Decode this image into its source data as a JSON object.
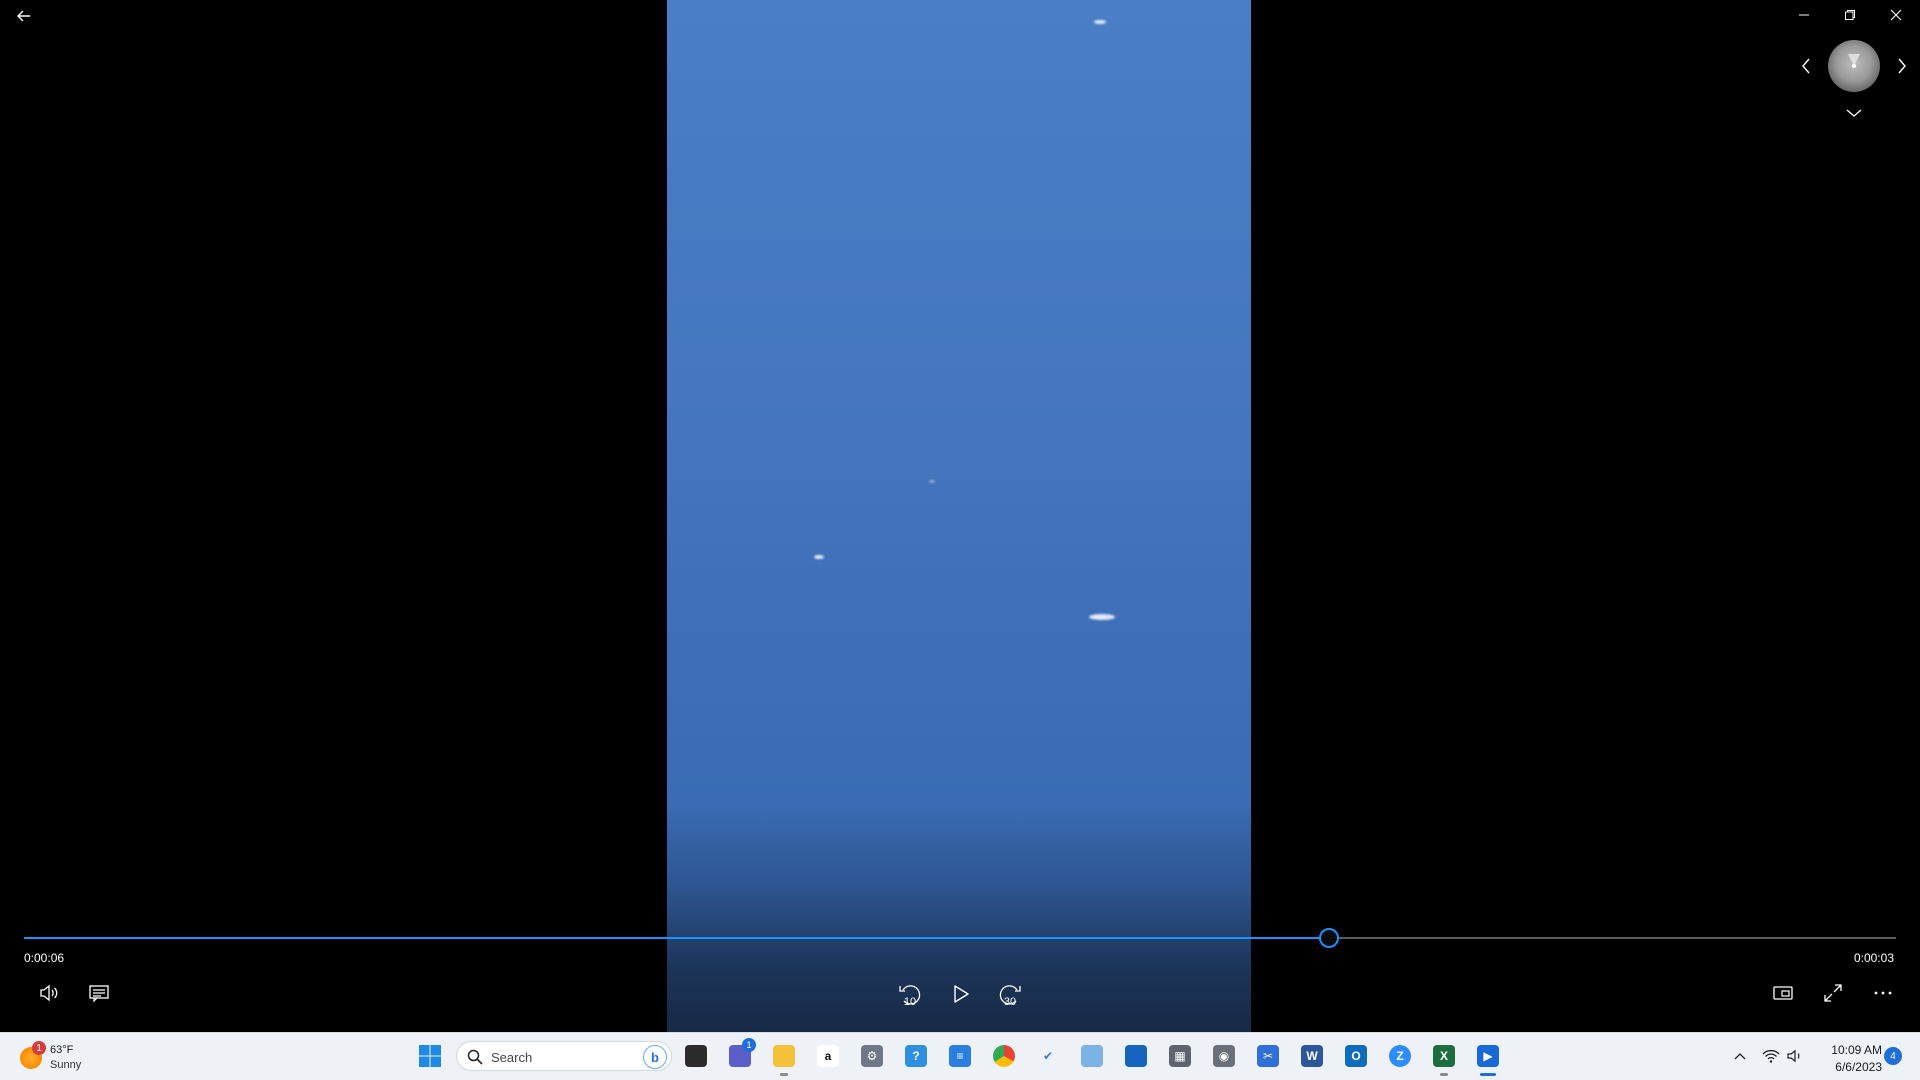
{
  "player": {
    "elapsed": "0:00:06",
    "remaining": "0:00:03",
    "progress_fraction": 0.697,
    "skip_back_seconds": "10",
    "skip_forward_seconds": "30"
  },
  "icons": {
    "back": "back-arrow-icon",
    "minimize": "minimize-icon",
    "restore": "restore-icon",
    "close": "close-icon",
    "prev": "chevron-left-icon",
    "next": "chevron-right-icon",
    "collapse": "chevron-down-icon",
    "volume": "speaker-icon",
    "captions": "captions-icon",
    "play": "play-icon",
    "miniplayer": "miniplayer-icon",
    "fullscreen": "fullscreen-icon",
    "more": "more-icon"
  },
  "colors": {
    "accent": "#1e90ff",
    "video_top": "#4a7ec6",
    "video_bottom": "#172a46"
  },
  "taskbar": {
    "weather": {
      "temp": "63°F",
      "condition": "Sunny",
      "badge": "1"
    },
    "search_placeholder": "Search",
    "apps": [
      {
        "name": "Task View",
        "badge": ""
      },
      {
        "name": "Teams",
        "badge": "1"
      },
      {
        "name": "File Explorer",
        "badge": ""
      },
      {
        "name": "Amazon",
        "badge": ""
      },
      {
        "name": "Settings",
        "badge": ""
      },
      {
        "name": "Get Help",
        "badge": ""
      },
      {
        "name": "Notepad",
        "badge": ""
      },
      {
        "name": "Chrome",
        "badge": ""
      },
      {
        "name": "To Do",
        "badge": ""
      },
      {
        "name": "Control Panel",
        "badge": ""
      },
      {
        "name": "Microsoft Store",
        "badge": ""
      },
      {
        "name": "Calculator",
        "badge": ""
      },
      {
        "name": "Camera",
        "badge": ""
      },
      {
        "name": "Snipping Tool",
        "badge": ""
      },
      {
        "name": "Word",
        "badge": ""
      },
      {
        "name": "Outlook",
        "badge": ""
      },
      {
        "name": "Zoom",
        "badge": ""
      },
      {
        "name": "Excel",
        "badge": ""
      },
      {
        "name": "Media Player",
        "badge": ""
      }
    ],
    "clock": {
      "time": "10:09 AM",
      "date": "6/6/2023"
    },
    "notifications": "4"
  }
}
